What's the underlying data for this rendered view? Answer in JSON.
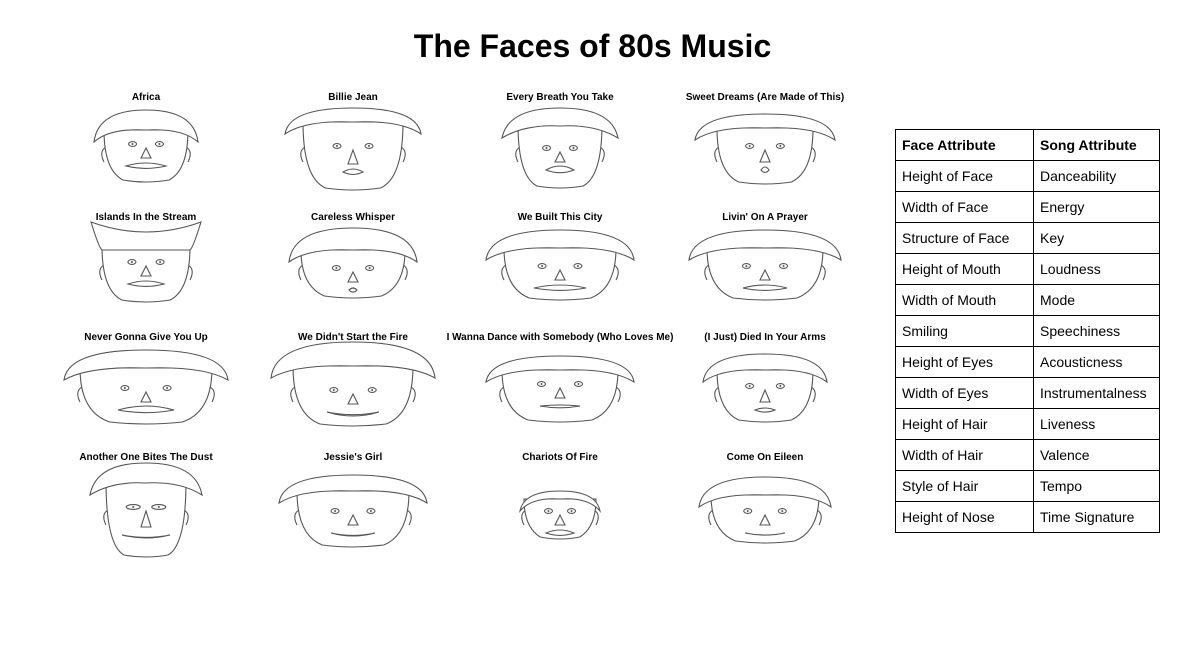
{
  "title": "The Faces of 80s Music",
  "chart_data": {
    "type": "chernoff_faces",
    "title": "The Faces of 80s Music",
    "faces": [
      {
        "song": "Africa"
      },
      {
        "song": "Billie Jean"
      },
      {
        "song": "Every Breath You Take"
      },
      {
        "song": "Sweet Dreams (Are Made of This)"
      },
      {
        "song": "Islands In the Stream"
      },
      {
        "song": "Careless Whisper"
      },
      {
        "song": "We Built This City"
      },
      {
        "song": "Livin' On A Prayer"
      },
      {
        "song": "Never Gonna Give You Up"
      },
      {
        "song": "We Didn't Start the Fire"
      },
      {
        "song": "I Wanna Dance with Somebody (Who Loves Me)"
      },
      {
        "song": "(I Just) Died In Your Arms"
      },
      {
        "song": "Another One Bites The Dust"
      },
      {
        "song": "Jessie's Girl"
      },
      {
        "song": "Chariots Of Fire"
      },
      {
        "song": "Come On Eileen"
      }
    ],
    "legend": {
      "headers": [
        "Face Attribute",
        "Song Attribute"
      ],
      "rows": [
        [
          "Height of Face",
          "Danceability"
        ],
        [
          "Width of Face",
          "Energy"
        ],
        [
          "Structure of Face",
          "Key"
        ],
        [
          "Height of Mouth",
          "Loudness"
        ],
        [
          "Width of Mouth",
          "Mode"
        ],
        [
          "Smiling",
          "Speechiness"
        ],
        [
          "Height of Eyes",
          "Acousticness"
        ],
        [
          "Width of Eyes",
          "Instrumentalness"
        ],
        [
          "Height of Hair",
          "Liveness"
        ],
        [
          "Width of Hair",
          "Valence"
        ],
        [
          "Style of Hair",
          "Tempo"
        ],
        [
          "Height of Nose",
          "Time Signature"
        ]
      ]
    }
  }
}
